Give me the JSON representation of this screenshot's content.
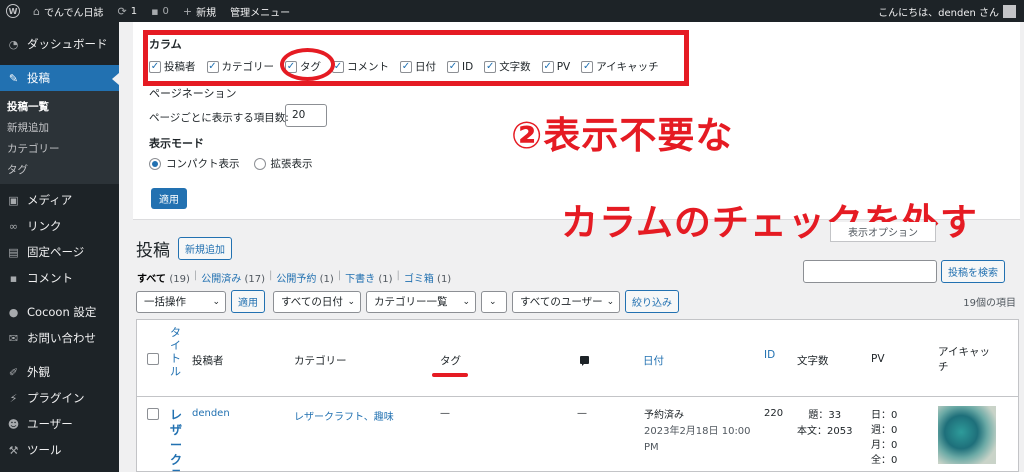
{
  "adminbar": {
    "site_name": "でんでん日誌",
    "updates": "1",
    "comments": "0",
    "new": "新規",
    "manage": "管理メニュー",
    "greeting": "こんにちは、denden さん"
  },
  "sidebar": {
    "items": [
      {
        "label": "ダッシュボード",
        "icon": "dashboard-icon"
      },
      {
        "label": "投稿",
        "icon": "pin-icon"
      },
      {
        "label": "メディア",
        "icon": "media-icon"
      },
      {
        "label": "リンク",
        "icon": "link-icon"
      },
      {
        "label": "固定ページ",
        "icon": "page-icon"
      },
      {
        "label": "コメント",
        "icon": "comment-icon"
      },
      {
        "label": "Cocoon 設定",
        "icon": "cocoon-icon"
      },
      {
        "label": "お問い合わせ",
        "icon": "mail-icon"
      },
      {
        "label": "外観",
        "icon": "appearance-icon"
      },
      {
        "label": "プラグイン",
        "icon": "plugin-icon"
      },
      {
        "label": "ユーザー",
        "icon": "user-icon"
      },
      {
        "label": "ツール",
        "icon": "tool-icon"
      }
    ],
    "submenu": [
      "投稿一覧",
      "新規追加",
      "カテゴリー",
      "タグ"
    ]
  },
  "screen_options": {
    "column_title": "カラム",
    "columns": [
      "投稿者",
      "カテゴリー",
      "タグ",
      "コメント",
      "日付",
      "ID",
      "文字数",
      "PV",
      "アイキャッチ"
    ],
    "pagination_title": "ページネーション",
    "per_page_label": "ページごとに表示する項目数:",
    "per_page_value": "20",
    "mode_title": "表示モード",
    "mode_compact": "コンパクト表示",
    "mode_extended": "拡張表示",
    "apply": "適用",
    "tab_label": "表示オプション"
  },
  "annotation": {
    "line1": "②表示不要な",
    "line2": "カラムのチェックを外す"
  },
  "main": {
    "title": "投稿",
    "add_new": "新規追加",
    "status": {
      "all": "すべて",
      "all_count": "(19)",
      "published": "公開済み",
      "published_count": "(17)",
      "scheduled": "公開予約",
      "scheduled_count": "(1)",
      "draft": "下書き",
      "draft_count": "(1)",
      "trash": "ゴミ箱",
      "trash_count": "(1)"
    },
    "search_button": "投稿を検索",
    "bulk": "一括操作",
    "apply": "適用",
    "dates": "すべての日付",
    "categories": "カテゴリー一覧",
    "users": "すべてのユーザー",
    "filter": "絞り込み",
    "item_count": "19個の項目"
  },
  "table": {
    "headers": {
      "title": "タイトル",
      "author": "投稿者",
      "category": "カテゴリー",
      "tag": "タグ",
      "date": "日付",
      "id": "ID",
      "chars": "文字数",
      "pv": "PV",
      "eyecatch": "アイキャッチ"
    },
    "row": {
      "title": "レザークラ",
      "author": "denden",
      "category": "レザークラフト、趣味",
      "tag": "—",
      "comments": "—",
      "date_status": "予約済み",
      "date_value": "2023年2月18日 10:00 PM",
      "id": "220",
      "chars_title": "題：33",
      "chars_body": "本文：2053",
      "pv_day": "日：0",
      "pv_week": "週：0",
      "pv_month": "月：0",
      "pv_all": "全：0"
    }
  },
  "colors": {
    "accent": "#2271b1",
    "annotation": "#e51b23",
    "sidebar": "#1d2327"
  }
}
